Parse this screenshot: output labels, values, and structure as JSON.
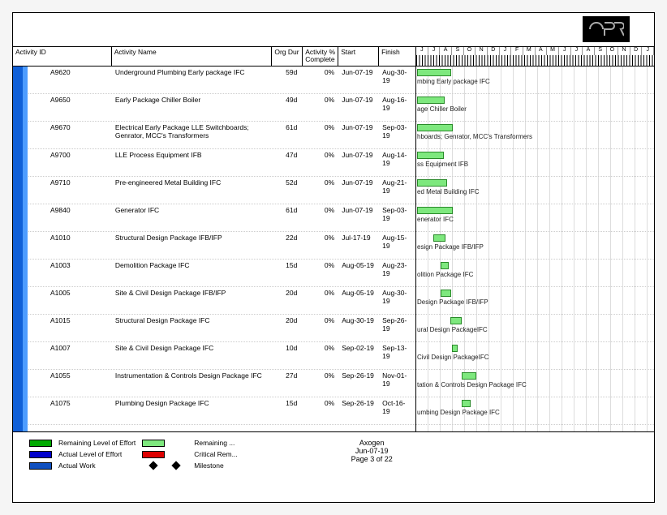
{
  "headers": {
    "id": "Activity ID",
    "name": "Activity Name",
    "dur": "Org Dur",
    "pct": "Activity % Complete",
    "start": "Start",
    "finish": "Finish"
  },
  "months": [
    "J",
    "J",
    "A",
    "S",
    "O",
    "N",
    "D",
    "J",
    "F",
    "M",
    "A",
    "M",
    "J",
    "J",
    "A",
    "S",
    "O",
    "N",
    "D",
    "J"
  ],
  "rows": [
    {
      "id": "A9620",
      "name": "Underground Plumbing Early package IFC",
      "dur": "59d",
      "pct": "0%",
      "start": "Jun-07-19",
      "finish": "Aug-30-19",
      "bx": 1,
      "bw": 42,
      "lbl": "mbing Early package IFC"
    },
    {
      "id": "A9650",
      "name": "Early Package Chiller Boiler",
      "dur": "49d",
      "pct": "0%",
      "start": "Jun-07-19",
      "finish": "Aug-16-19",
      "bx": 1,
      "bw": 34,
      "lbl": "age Chiller Boiler"
    },
    {
      "id": "A9670",
      "name": "Electrical Early Package LLE Switchboards; Genrator, MCC's Transformers",
      "dur": "61d",
      "pct": "0%",
      "start": "Jun-07-19",
      "finish": "Sep-03-19",
      "bx": 1,
      "bw": 44,
      "lbl": "hboards; Genrator, MCC's Transformers"
    },
    {
      "id": "A9700",
      "name": "LLE Process Equipment IFB",
      "dur": "47d",
      "pct": "0%",
      "start": "Jun-07-19",
      "finish": "Aug-14-19",
      "bx": 1,
      "bw": 33,
      "lbl": "ss Equipment IFB"
    },
    {
      "id": "A9710",
      "name": "Pre-engineered Metal Building IFC",
      "dur": "52d",
      "pct": "0%",
      "start": "Jun-07-19",
      "finish": "Aug-21-19",
      "bx": 1,
      "bw": 37,
      "lbl": "ed Metal Building IFC"
    },
    {
      "id": "A9840",
      "name": "Generator IFC",
      "dur": "61d",
      "pct": "0%",
      "start": "Jun-07-19",
      "finish": "Sep-03-19",
      "bx": 1,
      "bw": 44,
      "lbl": "enerator IFC"
    },
    {
      "id": "A1010",
      "name": "Structural Design Package IFB/IFP",
      "dur": "22d",
      "pct": "0%",
      "start": "Jul-17-19",
      "finish": "Aug-15-19",
      "bx": 21,
      "bw": 15,
      "lbl": "esign Package IFB/IFP"
    },
    {
      "id": "A1003",
      "name": "Demolition Package IFC",
      "dur": "15d",
      "pct": "0%",
      "start": "Aug-05-19",
      "finish": "Aug-23-19",
      "bx": 30,
      "bw": 10,
      "lbl": "olition Package IFC"
    },
    {
      "id": "A1005",
      "name": "Site & Civil Design Package IFB/IFP",
      "dur": "20d",
      "pct": "0%",
      "start": "Aug-05-19",
      "finish": "Aug-30-19",
      "bx": 30,
      "bw": 13,
      "lbl": "Design Package IFB/IFP"
    },
    {
      "id": "A1015",
      "name": "Structural Design Package IFC",
      "dur": "20d",
      "pct": "0%",
      "start": "Aug-30-19",
      "finish": "Sep-26-19",
      "bx": 42,
      "bw": 14,
      "lbl": "ural Design  PackageIFC"
    },
    {
      "id": "A1007",
      "name": "Site & Civil Design Package IFC",
      "dur": "10d",
      "pct": "0%",
      "start": "Sep-02-19",
      "finish": "Sep-13-19",
      "bx": 44,
      "bw": 7,
      "lbl": "Civil Design  PackageIFC"
    },
    {
      "id": "A1055",
      "name": "Instrumentation & Controls Design Package IFC",
      "dur": "27d",
      "pct": "0%",
      "start": "Sep-26-19",
      "finish": "Nov-01-19",
      "bx": 56,
      "bw": 18,
      "lbl": "tation & Controls Design Package IFC"
    },
    {
      "id": "A1075",
      "name": "Plumbing Design  Package IFC",
      "dur": "15d",
      "pct": "0%",
      "start": "Sep-26-19",
      "finish": "Oct-16-19",
      "bx": 56,
      "bw": 11,
      "lbl": "umbing Design Package IFC"
    }
  ],
  "legend": {
    "l1": "Remaining Level of Effort",
    "l2": "Actual Level of Effort",
    "l3": "Actual Work",
    "l4": "Remaining ...",
    "l5": "Critical Rem...",
    "l6": "Milestone"
  },
  "footer": {
    "proj": "Axogen",
    "date": "Jun-07-19",
    "page": "Page 3 of 22"
  },
  "logo": "CRB"
}
